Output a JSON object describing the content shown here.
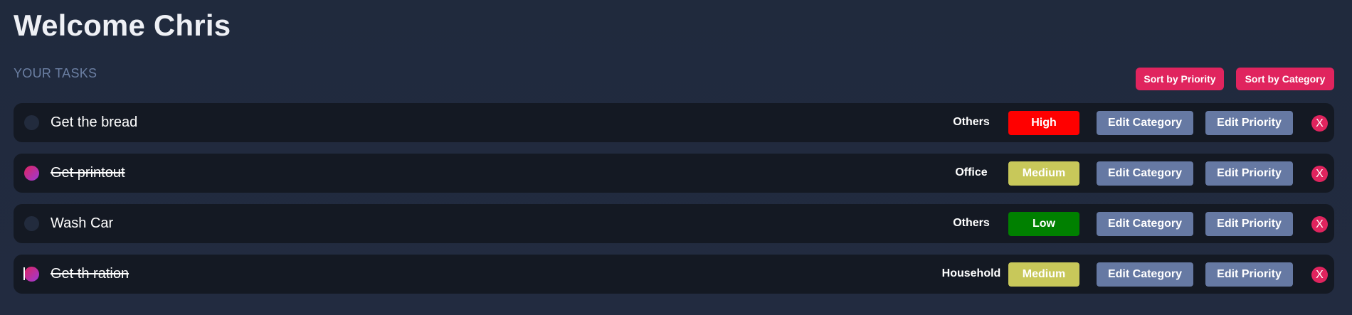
{
  "header": {
    "title": "Welcome Chris",
    "section_label": "YOUR TASKS"
  },
  "sort": {
    "by_priority_label": "Sort by Priority",
    "by_category_label": "Sort by Category"
  },
  "actions": {
    "edit_category_label": "Edit Category",
    "edit_priority_label": "Edit Priority",
    "delete_label": "X"
  },
  "colors": {
    "background": "#212a3e",
    "row_background": "#141923",
    "accent": "#e0245e",
    "edit_button": "#6679a3",
    "priority_high": "#ff0000",
    "priority_medium": "#c8c85a",
    "priority_low": "#008000"
  },
  "tasks": [
    {
      "text": "Get the bread",
      "completed": false,
      "category": "Others",
      "priority": "High",
      "priority_color": "#ff0000"
    },
    {
      "text": "Get printout",
      "completed": true,
      "category": "Office",
      "priority": "Medium",
      "priority_color": "#c8c85a"
    },
    {
      "text": "Wash Car",
      "completed": false,
      "category": "Others",
      "priority": "Low",
      "priority_color": "#008000"
    },
    {
      "text": "Get th ration",
      "completed": true,
      "category": "Household",
      "priority": "Medium",
      "priority_color": "#c8c85a"
    }
  ]
}
